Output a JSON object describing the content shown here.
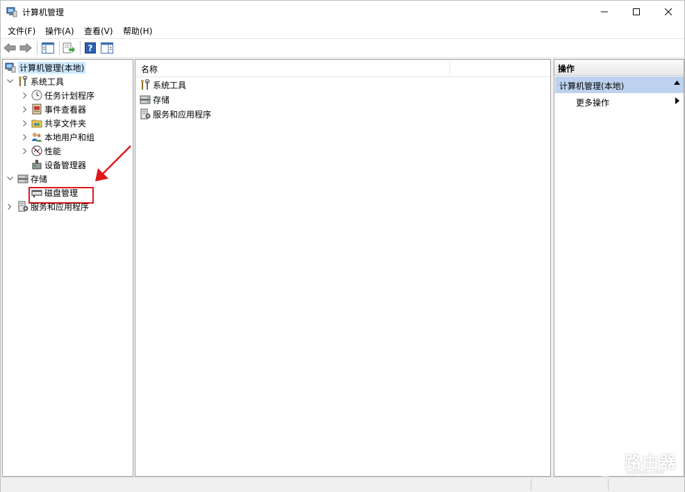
{
  "window": {
    "title": "计算机管理"
  },
  "menu": {
    "items": [
      "文件(F)",
      "操作(A)",
      "查看(V)",
      "帮助(H)"
    ]
  },
  "tree": {
    "root": "计算机管理(本地)",
    "system_tools": "系统工具",
    "task_scheduler": "任务计划程序",
    "event_viewer": "事件查看器",
    "shared_folders": "共享文件夹",
    "local_users": "本地用户和组",
    "performance": "性能",
    "device_manager": "设备管理器",
    "storage": "存储",
    "disk_management": "磁盘管理",
    "services_apps": "服务和应用程序"
  },
  "list": {
    "column_name": "名称",
    "items": [
      "系统工具",
      "存储",
      "服务和应用程序"
    ]
  },
  "actions": {
    "header": "操作",
    "group": "计算机管理(本地)",
    "more": "更多操作"
  },
  "watermark": {
    "text": "路由器",
    "sub": "luyouqi.com"
  },
  "colors": {
    "selection": "#cce8ff",
    "action_group": "#bcd2ee",
    "annotation": "#e0161b"
  }
}
